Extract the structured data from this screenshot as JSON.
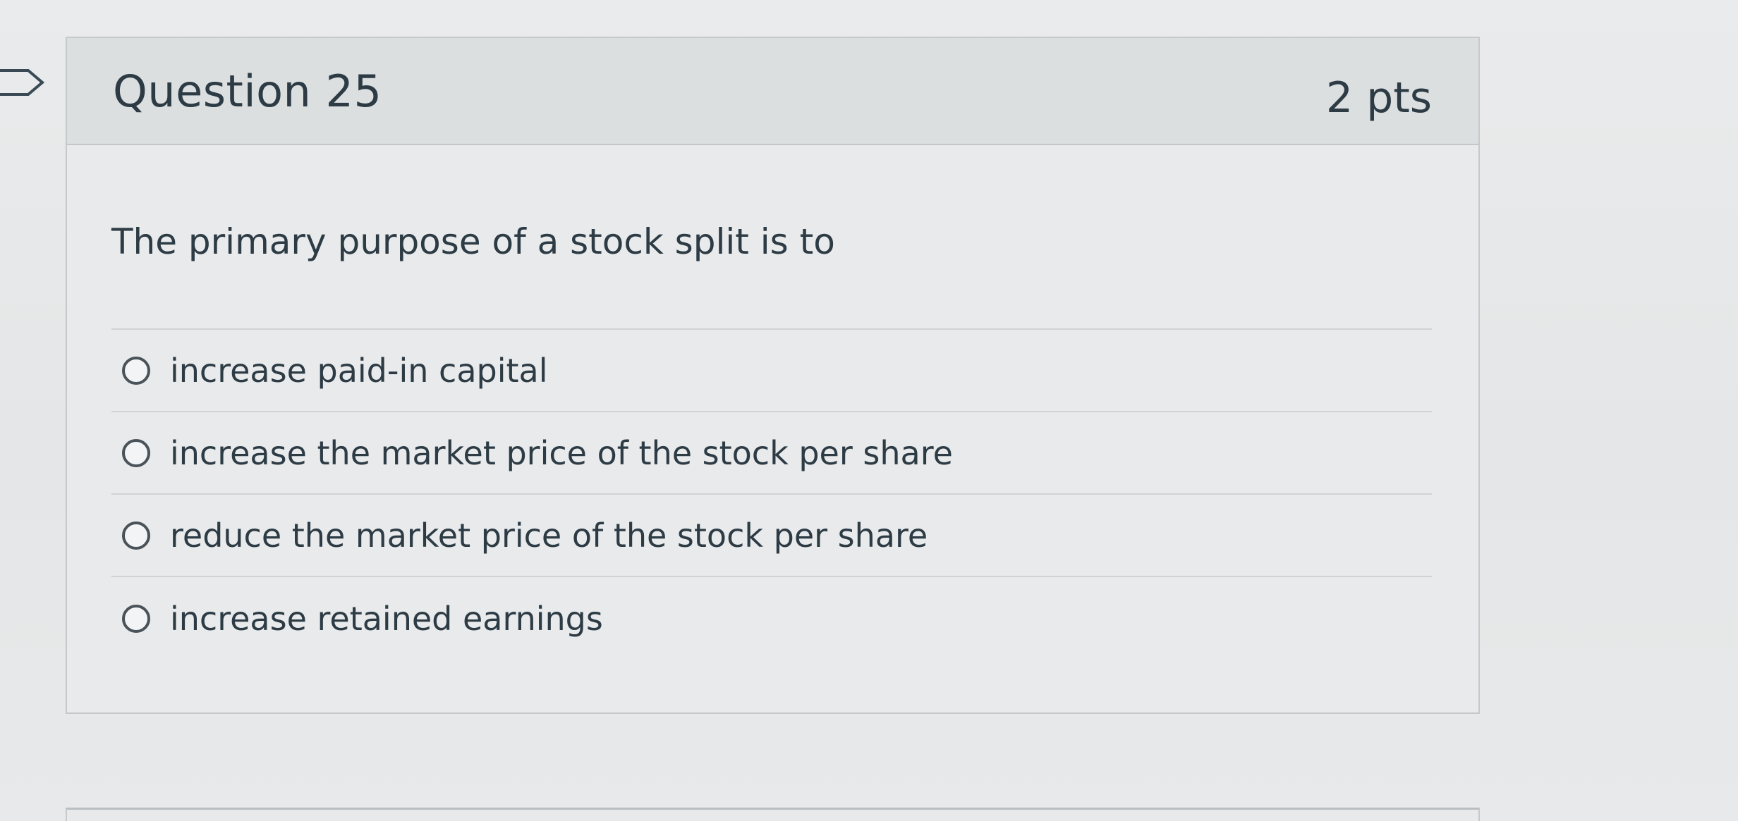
{
  "question": {
    "title": "Question 25",
    "points": "2 pts",
    "prompt": "The primary purpose of a stock split is to",
    "answers": [
      "increase paid-in capital",
      "increase the market price of the stock per share",
      "reduce the market price of the stock per share",
      "increase retained earnings"
    ]
  },
  "icons": {
    "flag": "bookmark-flag-icon",
    "radio": "radio-unselected-icon"
  }
}
